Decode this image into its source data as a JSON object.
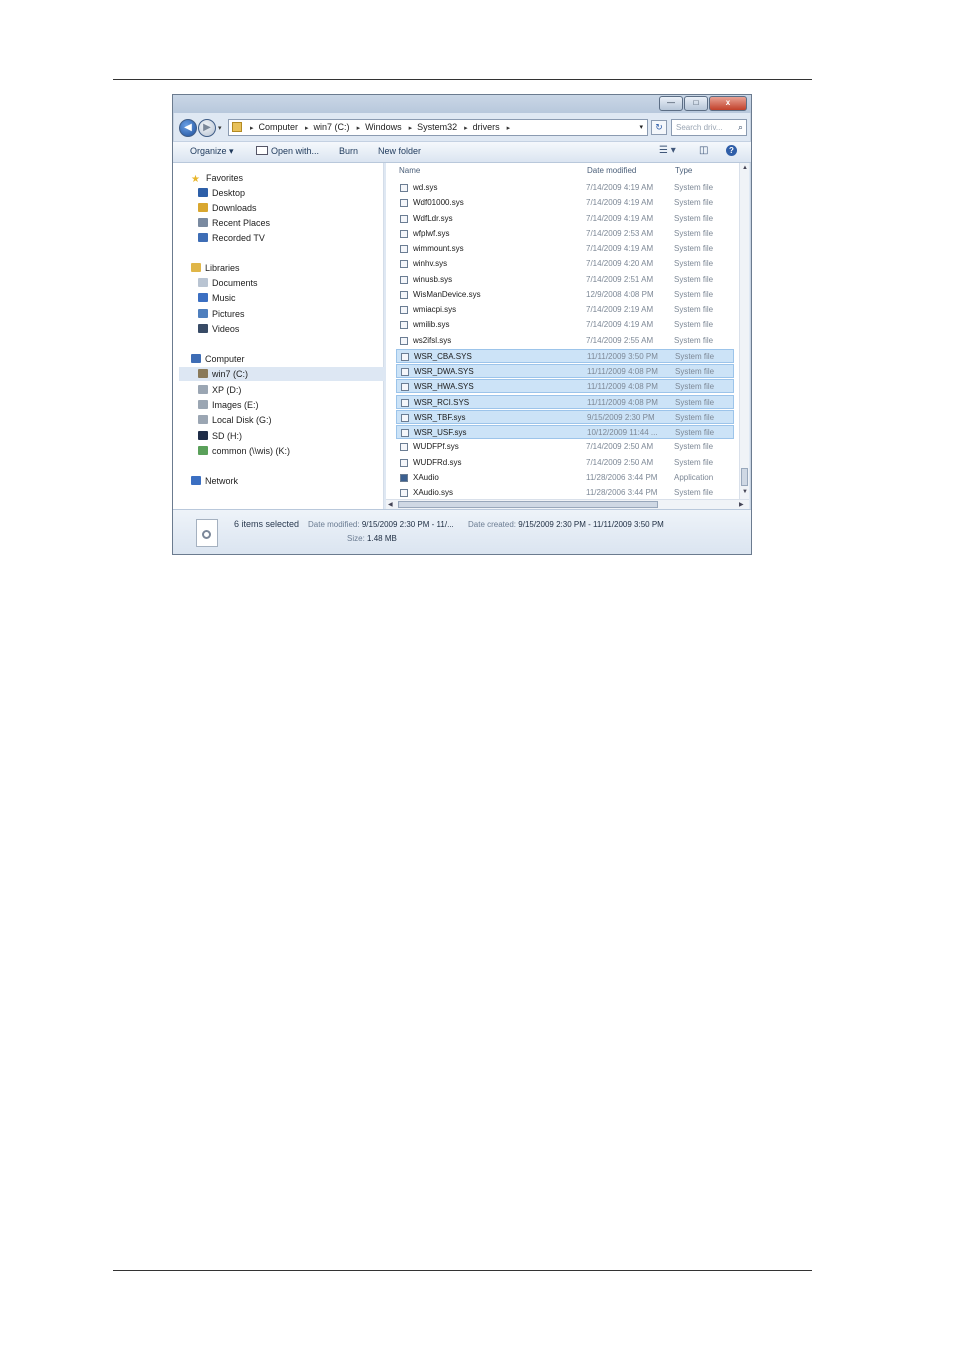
{
  "window": {
    "controls": {
      "minimize": "—",
      "maximize": "□",
      "close": "x"
    }
  },
  "address": {
    "back_glyph": "◀",
    "forward_glyph": "▶",
    "crumbs": [
      "Computer",
      "win7 (C:)",
      "Windows",
      "System32",
      "drivers"
    ],
    "separator": "▸",
    "dropdown_glyph": "▾",
    "refresh_glyph": "↻",
    "search_placeholder": "Search driv...",
    "search_icon": "⌕"
  },
  "toolbar": {
    "organize": "Organize ▾",
    "open_with": "Open with...",
    "burn": "Burn",
    "new_folder": "New folder",
    "views_glyph": "☰ ▾",
    "preview_glyph": "◫",
    "help_glyph": "?"
  },
  "nav": {
    "items": [
      {
        "label": "Favorites",
        "icon": "star-icon",
        "color": "#e8b62c"
      },
      {
        "label": "Desktop",
        "icon": "desktop-icon",
        "color": "#2d5fa8"
      },
      {
        "label": "Downloads",
        "icon": "downloads-folder-icon",
        "color": "#d9a72f"
      },
      {
        "label": "Recent Places",
        "icon": "recent-places-icon",
        "color": "#7a8aa0"
      },
      {
        "label": "Recorded TV",
        "icon": "recorded-tv-icon",
        "color": "#3e6db5"
      },
      {
        "label": "Libraries",
        "icon": "libraries-icon",
        "color": "#e0b648"
      },
      {
        "label": "Documents",
        "icon": "documents-icon",
        "color": "#b9c4d2"
      },
      {
        "label": "Music",
        "icon": "music-icon",
        "color": "#3b6fc2"
      },
      {
        "label": "Pictures",
        "icon": "pictures-icon",
        "color": "#4f7fbe"
      },
      {
        "label": "Videos",
        "icon": "videos-icon",
        "color": "#384b66"
      },
      {
        "label": "Computer",
        "icon": "computer-icon",
        "color": "#3e6db5"
      },
      {
        "label": "win7 (C:)",
        "icon": "drive-c-icon",
        "color": "#8a7a5a"
      },
      {
        "label": "XP (D:)",
        "icon": "drive-icon",
        "color": "#9ba6b3"
      },
      {
        "label": "Images (E:)",
        "icon": "drive-icon",
        "color": "#9ba6b3"
      },
      {
        "label": "Local Disk (G:)",
        "icon": "drive-icon",
        "color": "#9ba6b3"
      },
      {
        "label": "SD (H:)",
        "icon": "sd-card-icon",
        "color": "#1f2d48"
      },
      {
        "label": "common (\\\\wis) (K:)",
        "icon": "network-drive-icon",
        "color": "#5aa05a"
      },
      {
        "label": "Network",
        "icon": "network-icon",
        "color": "#3b6fc2"
      }
    ]
  },
  "files": {
    "columns": {
      "name": "Name",
      "date": "Date modified",
      "type": "Type"
    },
    "rows": [
      {
        "name": "wd.sys",
        "date": "7/14/2009 4:19 AM",
        "type": "System file",
        "selected": false
      },
      {
        "name": "Wdf01000.sys",
        "date": "7/14/2009 4:19 AM",
        "type": "System file",
        "selected": false
      },
      {
        "name": "WdfLdr.sys",
        "date": "7/14/2009 4:19 AM",
        "type": "System file",
        "selected": false
      },
      {
        "name": "wfplwf.sys",
        "date": "7/14/2009 2:53 AM",
        "type": "System file",
        "selected": false
      },
      {
        "name": "wimmount.sys",
        "date": "7/14/2009 4:19 AM",
        "type": "System file",
        "selected": false
      },
      {
        "name": "winhv.sys",
        "date": "7/14/2009 4:20 AM",
        "type": "System file",
        "selected": false
      },
      {
        "name": "winusb.sys",
        "date": "7/14/2009 2:51 AM",
        "type": "System file",
        "selected": false
      },
      {
        "name": "WisManDevice.sys",
        "date": "12/9/2008 4:08 PM",
        "type": "System file",
        "selected": false
      },
      {
        "name": "wmiacpi.sys",
        "date": "7/14/2009 2:19 AM",
        "type": "System file",
        "selected": false
      },
      {
        "name": "wmilib.sys",
        "date": "7/14/2009 4:19 AM",
        "type": "System file",
        "selected": false
      },
      {
        "name": "ws2ifsl.sys",
        "date": "7/14/2009 2:55 AM",
        "type": "System file",
        "selected": false
      },
      {
        "name": "WSR_CBA.SYS",
        "date": "11/11/2009 3:50 PM",
        "type": "System file",
        "selected": true
      },
      {
        "name": "WSR_DWA.SYS",
        "date": "11/11/2009 4:08 PM",
        "type": "System file",
        "selected": true
      },
      {
        "name": "WSR_HWA.SYS",
        "date": "11/11/2009 4:08 PM",
        "type": "System file",
        "selected": true
      },
      {
        "name": "WSR_RCI.SYS",
        "date": "11/11/2009 4:08 PM",
        "type": "System file",
        "selected": true
      },
      {
        "name": "WSR_TBF.sys",
        "date": "9/15/2009 2:30 PM",
        "type": "System file",
        "selected": true
      },
      {
        "name": "WSR_USF.sys",
        "date": "10/12/2009 11:44 ...",
        "type": "System file",
        "selected": true
      },
      {
        "name": "WUDFPf.sys",
        "date": "7/14/2009 2:50 AM",
        "type": "System file",
        "selected": false
      },
      {
        "name": "WUDFRd.sys",
        "date": "7/14/2009 2:50 AM",
        "type": "System file",
        "selected": false
      },
      {
        "name": "XAudio",
        "date": "11/28/2006 3:44 PM",
        "type": "Application",
        "selected": false
      },
      {
        "name": "XAudio.sys",
        "date": "11/28/2006 3:44 PM",
        "type": "System file",
        "selected": false
      }
    ]
  },
  "details": {
    "count": "6 items selected",
    "modified_label": "Date modified:",
    "modified_value": "9/15/2009 2:30 PM - 11/...",
    "created_label": "Date created:",
    "created_value": "9/15/2009 2:30 PM - 11/11/2009 3:50 PM",
    "size_label": "Size:",
    "size_value": "1.48 MB"
  }
}
